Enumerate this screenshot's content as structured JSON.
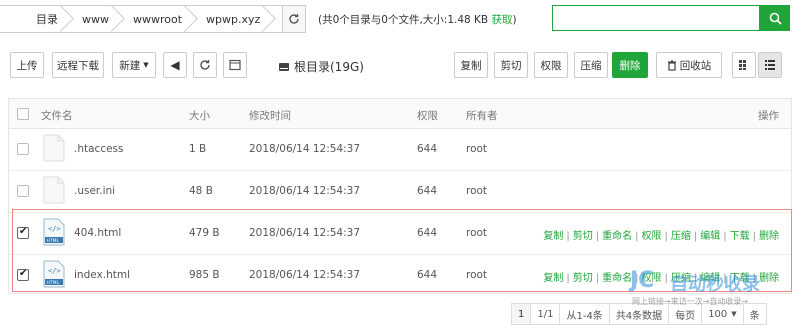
{
  "breadcrumb": [
    "目录",
    "www",
    "wwwroot",
    "wpwp.xyz"
  ],
  "dir_info": {
    "text": "(共0个目录与0个文件,大小:1.48 KB",
    "link": "获取",
    "close": ")"
  },
  "search": {
    "placeholder": ""
  },
  "toolbar": {
    "upload": "上传",
    "remote_download": "远程下载",
    "new": "新建",
    "root_label": "根目录(19G)",
    "copy": "复制",
    "cut": "剪切",
    "permission": "权限",
    "compress": "压缩",
    "delete": "删除",
    "recycle_bin": "回收站"
  },
  "table": {
    "headers": {
      "name": "文件名",
      "size": "大小",
      "mtime": "修改时间",
      "perm": "权限",
      "owner": "所有者",
      "ops": "操作"
    },
    "rows": [
      {
        "name": ".htaccess",
        "size": "1 B",
        "mtime": "2018/06/14 12:54:37",
        "perm": "644",
        "owner": "root",
        "checked": false,
        "type": "file"
      },
      {
        "name": ".user.ini",
        "size": "48 B",
        "mtime": "2018/06/14 12:54:37",
        "perm": "644",
        "owner": "root",
        "checked": false,
        "type": "file"
      },
      {
        "name": "404.html",
        "size": "479 B",
        "mtime": "2018/06/14 12:54:37",
        "perm": "644",
        "owner": "root",
        "checked": true,
        "type": "html"
      },
      {
        "name": "index.html",
        "size": "985 B",
        "mtime": "2018/06/14 12:54:37",
        "perm": "644",
        "owner": "root",
        "checked": true,
        "type": "html"
      }
    ],
    "ops": [
      "复制",
      "剪切",
      "重命名",
      "权限",
      "压缩",
      "编辑",
      "下载",
      "删除"
    ]
  },
  "pager": {
    "page": "1",
    "range": "1/1",
    "from_to": "从1-4条",
    "total": "共4条数据",
    "per_page_label": "每页",
    "per_page": "100",
    "unit": "条"
  },
  "watermark": {
    "logo": "JC",
    "title": "自动秒收录",
    "sub": "网上链接→来访一次→自动收录→"
  },
  "colors": {
    "accent": "#20a53a",
    "selected_border": "#e88888"
  }
}
